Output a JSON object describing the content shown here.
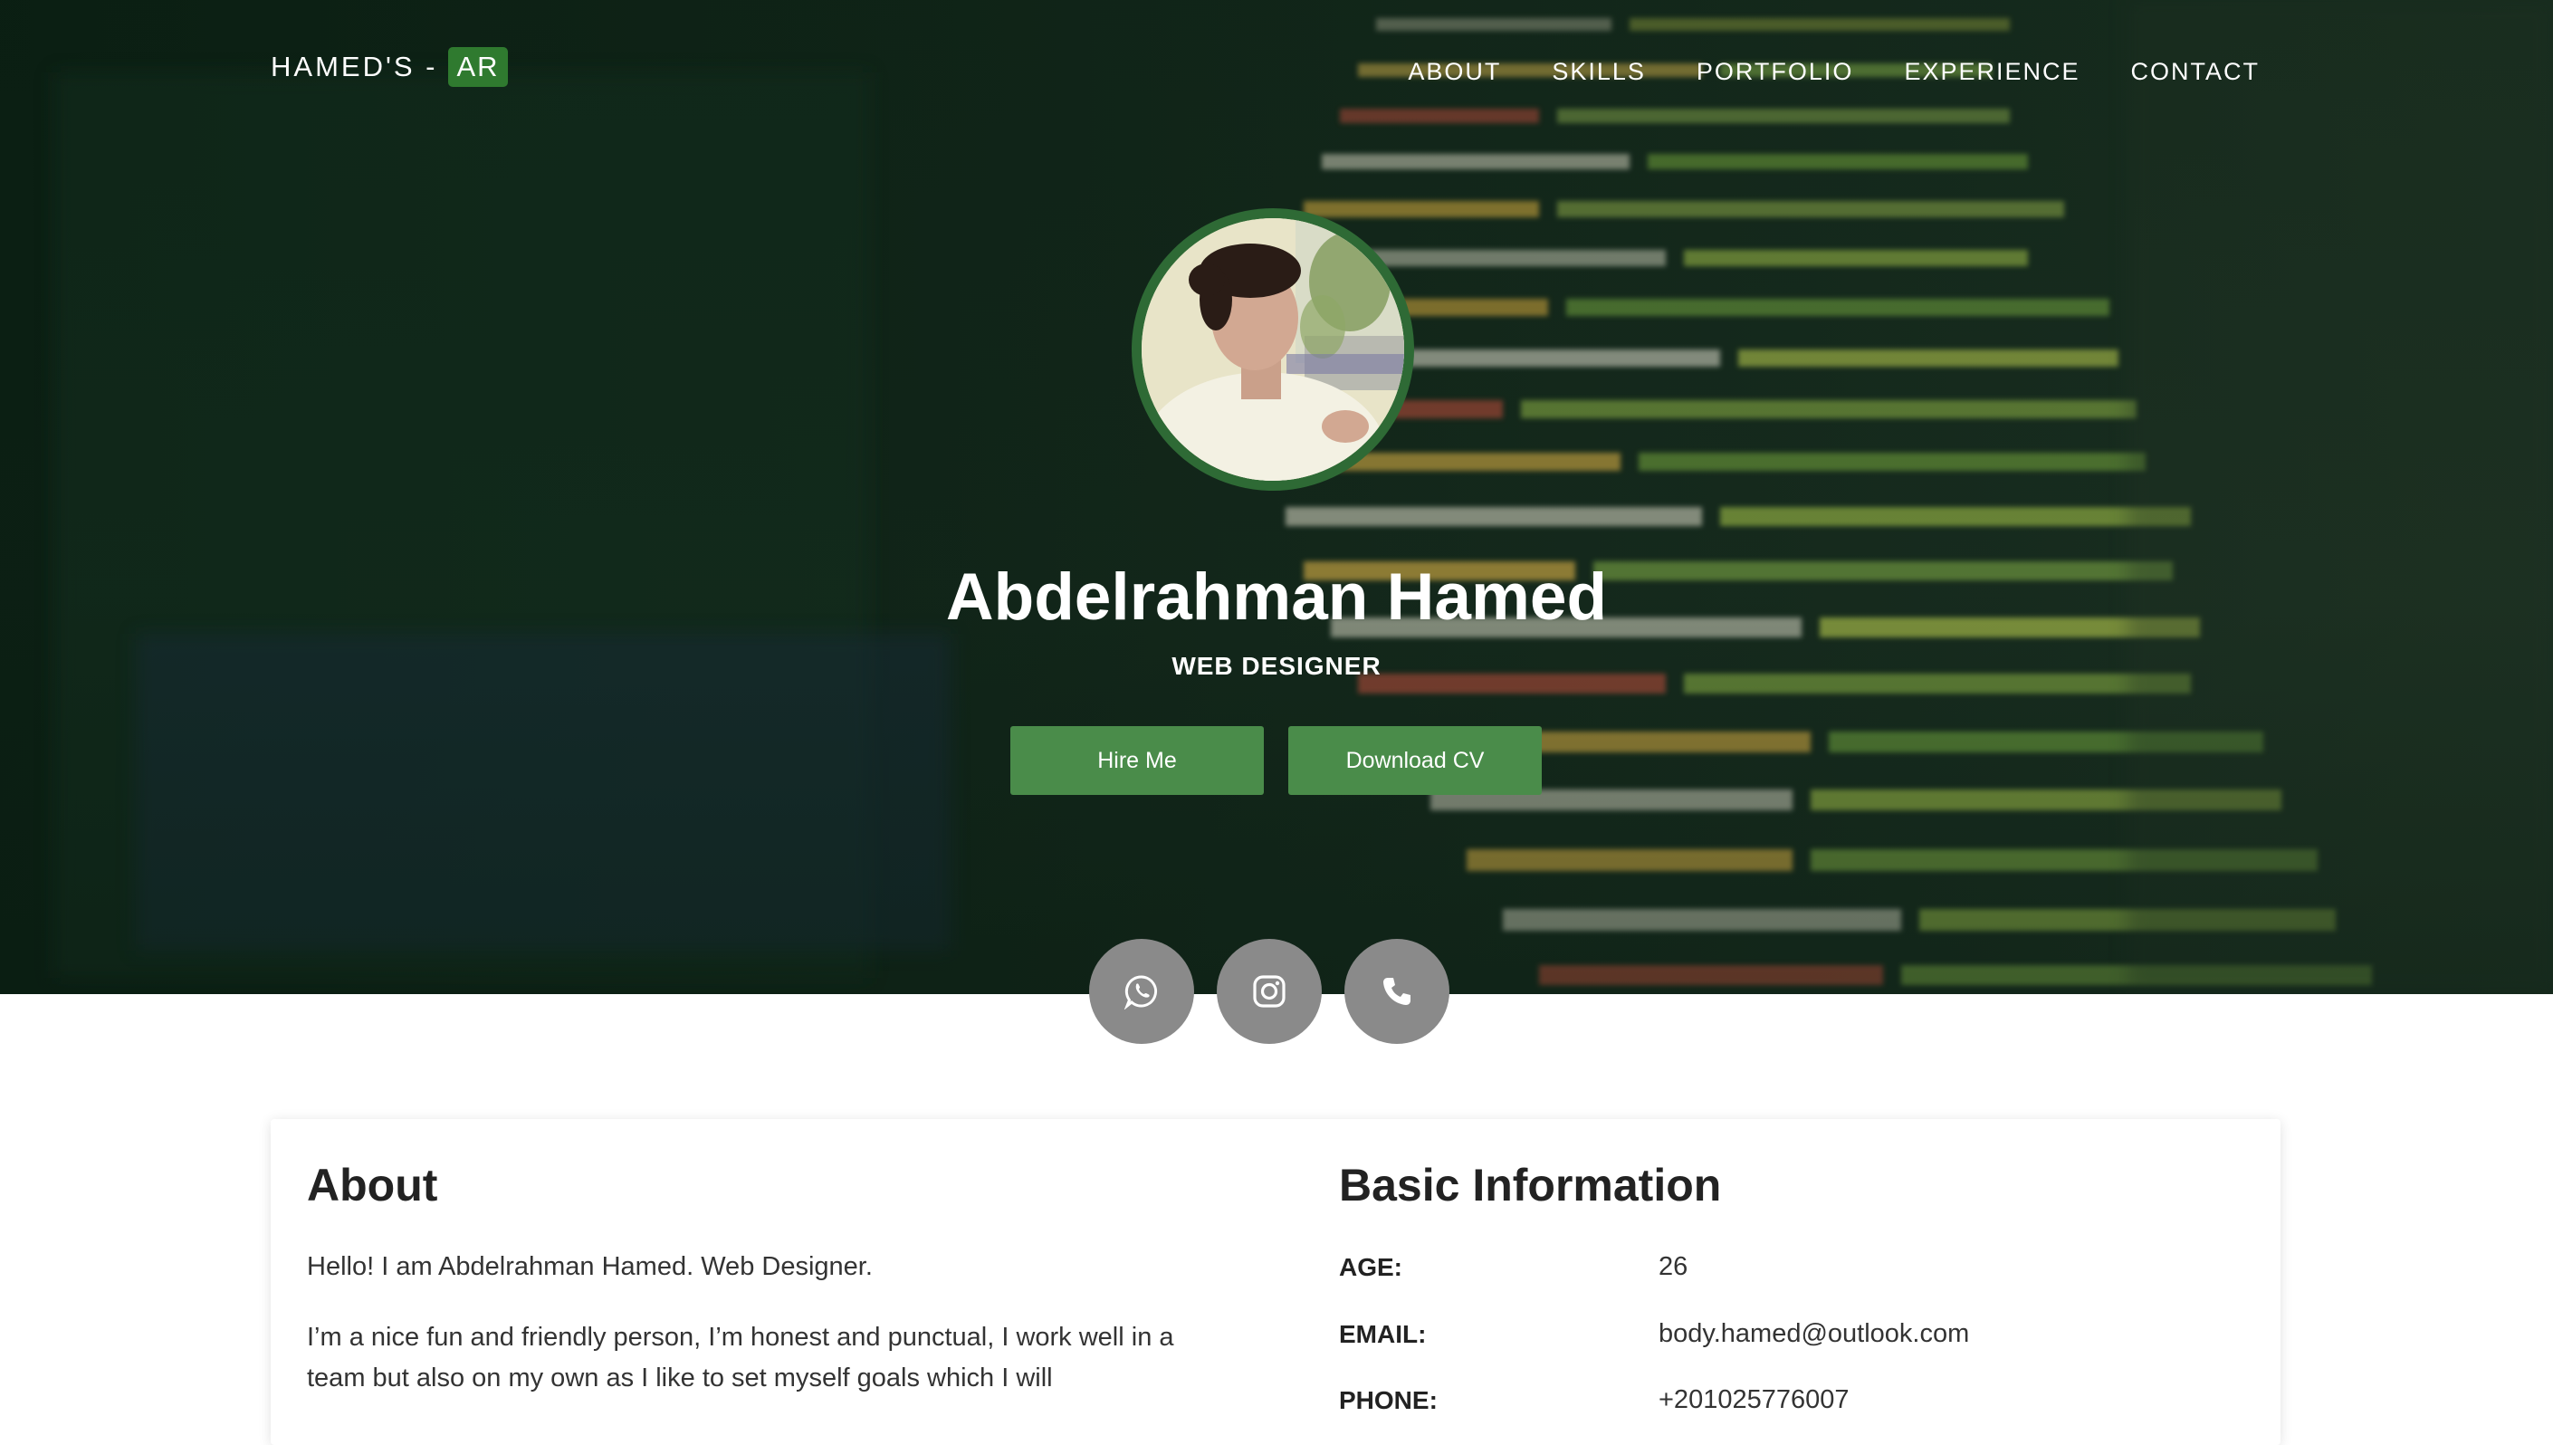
{
  "nav": {
    "brand_prefix": "HAMED'S -",
    "brand_badge": "AR",
    "links": [
      "ABOUT",
      "SKILLS",
      "PORTFOLIO",
      "EXPERIENCE",
      "CONTACT"
    ]
  },
  "hero": {
    "name": "Abdelrahman Hamed",
    "role": "WEB DESIGNER",
    "buttons": {
      "hire": "Hire Me",
      "download": "Download CV"
    },
    "social_icons": [
      "whatsapp-icon",
      "instagram-icon",
      "phone-icon"
    ]
  },
  "about": {
    "title": "About",
    "intro": "Hello! I am Abdelrahman Hamed. Web Designer.",
    "body": "I’m a nice fun and friendly person, I’m honest and punctual, I work well in a team but also on my own as I like to set myself goals which I will"
  },
  "basic_info": {
    "title": "Basic Information",
    "rows": [
      {
        "label": "AGE:",
        "value": "26"
      },
      {
        "label": "EMAIL:",
        "value": "body.hamed@outlook.com"
      },
      {
        "label": "PHONE:",
        "value": "+201025776007"
      }
    ]
  },
  "colors": {
    "accent": "#4a8c4a",
    "badge": "#2f7a2f",
    "social": "#8a8a8a",
    "hero_dark": "#13281b"
  }
}
